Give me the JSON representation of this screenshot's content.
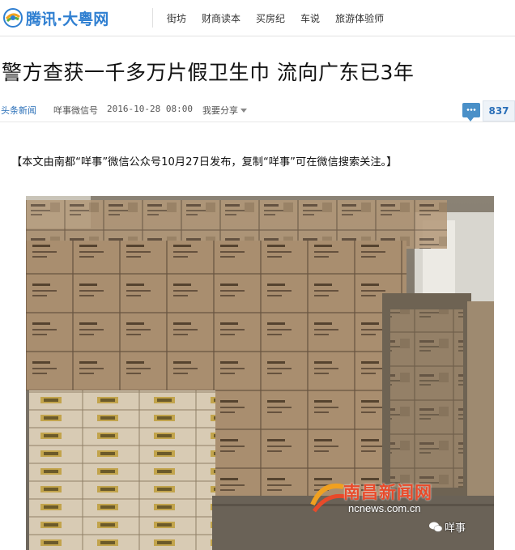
{
  "header": {
    "logo_text_1": "腾讯",
    "logo_sep": "·",
    "logo_text_2": "大粤网",
    "nav": [
      "街坊",
      "财商读本",
      "买房纪",
      "车说",
      "旅游体验师"
    ]
  },
  "article": {
    "title": "警方查获一千多万片假卫生巾 流向广东已3年",
    "category": "头条新闻",
    "source": "咩事微信号",
    "time": "2016-10-28 08:00",
    "share_label": "我要分享",
    "comment_count": "837",
    "intro": "【本文由南都“咩事”微信公众号10月27日发布，复制“咩事”可在微信搜索关注。】"
  },
  "photo": {
    "watermark_cn": "南昌新闻网",
    "watermark_url": "ncnews.com.cn",
    "wechat_label": "咩事"
  },
  "colors": {
    "brand_blue": "#2f7fd1",
    "link_blue": "#2a6fb8",
    "watermark_red": "#e84a2a"
  }
}
